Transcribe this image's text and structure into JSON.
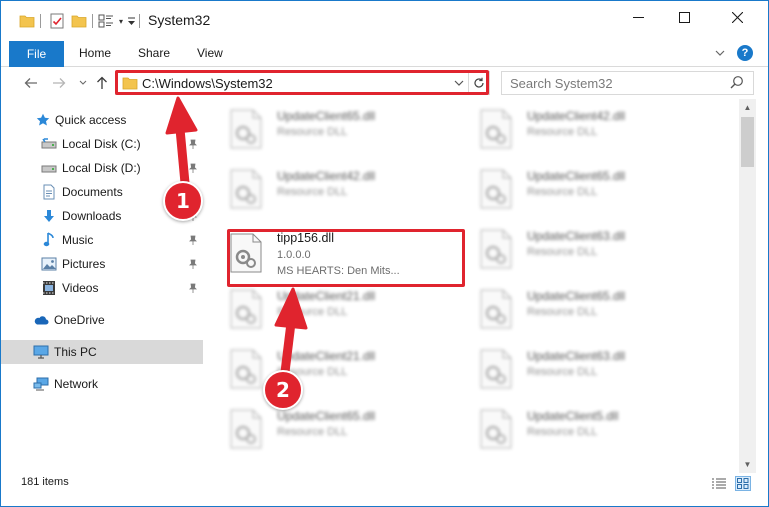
{
  "window": {
    "title": "System32",
    "accent": "#1979ca",
    "annotation_color": "#e0242e"
  },
  "ribbon": {
    "tabs": [
      {
        "label": "File"
      },
      {
        "label": "Home"
      },
      {
        "label": "Share"
      },
      {
        "label": "View"
      }
    ],
    "help_label": "?"
  },
  "navigation": {
    "address": "C:\\Windows\\System32",
    "search_placeholder": "Search System32"
  },
  "sidebar": {
    "items": [
      {
        "label": "Quick access",
        "icon": "star-icon",
        "pinned": false
      },
      {
        "label": "Local Disk (C:)",
        "icon": "drive-icon",
        "pinned": true
      },
      {
        "label": "Local Disk (D:)",
        "icon": "drive-icon",
        "pinned": true
      },
      {
        "label": "Documents",
        "icon": "documents-icon",
        "pinned": true
      },
      {
        "label": "Downloads",
        "icon": "download-icon",
        "pinned": true
      },
      {
        "label": "Music",
        "icon": "music-icon",
        "pinned": true
      },
      {
        "label": "Pictures",
        "icon": "pictures-icon",
        "pinned": true
      },
      {
        "label": "Videos",
        "icon": "videos-icon",
        "pinned": true
      },
      {
        "label": "OneDrive",
        "icon": "cloud-icon",
        "pinned": false
      },
      {
        "label": "This PC",
        "icon": "computer-icon",
        "pinned": false,
        "selected": true
      },
      {
        "label": "Network",
        "icon": "network-icon",
        "pinned": false
      }
    ]
  },
  "files": {
    "left_column": [
      {
        "name": "UpdateClient65.dll",
        "type": "Resource DLL"
      },
      {
        "name": "UpdateClient42.dll",
        "type": "Resource DLL"
      },
      {
        "name": "tipp156.dll",
        "type": "1.0.0.0",
        "company": "MS HEARTS: Den Mits..."
      },
      {
        "name": "UpdateClient21.dll",
        "type": "Resource DLL"
      },
      {
        "name": "UpdateClient21.dll",
        "type": "Resource DLL"
      },
      {
        "name": "UpdateClient65.dll",
        "type": "Resource DLL"
      }
    ],
    "right_column": [
      {
        "name": "UpdateClient42.dll",
        "type": "Resource DLL"
      },
      {
        "name": "UpdateClient65.dll",
        "type": "Resource DLL"
      },
      {
        "name": "UpdateClient63.dll",
        "type": "Resource DLL"
      },
      {
        "name": "UpdateClient65.dll",
        "type": "Resource DLL"
      },
      {
        "name": "UpdateClient63.dll",
        "type": "Resource DLL"
      },
      {
        "name": "UpdateClient5.dll",
        "type": "Resource DLL"
      }
    ]
  },
  "status": {
    "item_count": "181 items"
  },
  "annotations": {
    "step1": "1",
    "step2": "2"
  }
}
